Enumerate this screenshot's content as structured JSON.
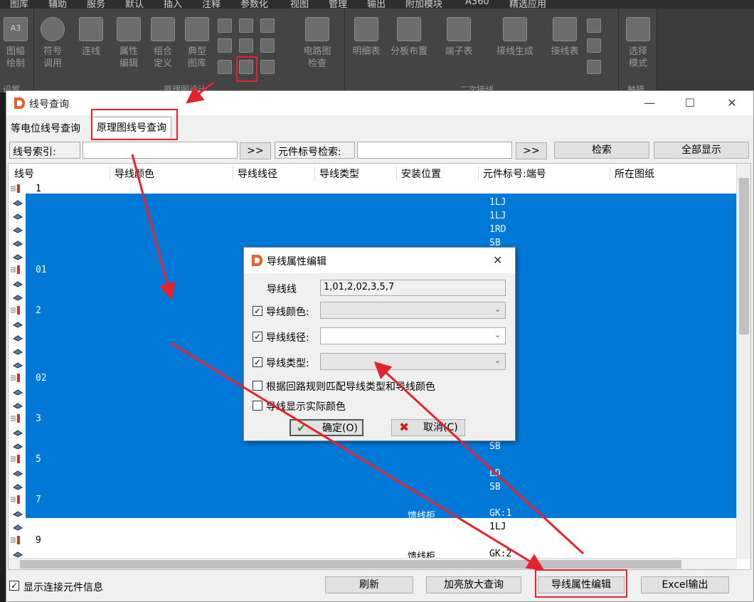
{
  "ribbon": {
    "menu": [
      "图库",
      "辅助",
      "服务",
      "默认",
      "插入",
      "注释",
      "参数化",
      "视图",
      "管理",
      "输出",
      "附加模块",
      "A360",
      "精选应用"
    ],
    "buttons": [
      {
        "line1": "图幅",
        "line2": "绘制"
      },
      {
        "line1": "符号",
        "line2": "调用"
      },
      {
        "line1": "连线",
        "line2": ""
      },
      {
        "line1": "属性",
        "line2": "编辑"
      },
      {
        "line1": "组合",
        "line2": "定义"
      },
      {
        "line1": "典型",
        "line2": "图库"
      },
      {
        "line1": "电路图",
        "line2": "检查"
      },
      {
        "line1": "明细表",
        "line2": ""
      },
      {
        "line1": "分板布置",
        "line2": ""
      },
      {
        "line1": "端子表",
        "line2": ""
      },
      {
        "line1": "接线生成",
        "line2": ""
      },
      {
        "line1": "接线表",
        "line2": ""
      },
      {
        "line1": "选择",
        "line2": "模式"
      }
    ],
    "groups": [
      "设置",
      "原理图设计",
      "二次接线",
      "触摸"
    ],
    "a3_label": "A3"
  },
  "window": {
    "title": "线号查询",
    "tabs": [
      "等电位线号查询",
      "原理图线号查询"
    ],
    "wire_index_label": "线号索引:",
    "wire_index_value": "",
    "elem_search_label": "元件标号检索:",
    "elem_search_value": "",
    "go_label": ">>",
    "search_button": "检索",
    "show_all_button": "全部显示",
    "columns": [
      "线号",
      "导线颜色",
      "导线线径",
      "导线类型",
      "安装位置",
      "元件标号:端号",
      "所在图纸"
    ],
    "rows": [
      {
        "wire": "1",
        "elems": [
          "1LJ",
          "1LJ",
          "1RD",
          "SB"
        ]
      },
      {
        "wire": "01"
      },
      {
        "wire": "2"
      },
      {
        "wire": "02"
      },
      {
        "wire": "3"
      },
      {
        "wire": "5",
        "elems": [
          "SB",
          "LD",
          "SB"
        ]
      },
      {
        "wire": "7",
        "location": "馈线柜",
        "elem": "GK:1"
      },
      {
        "wire": "",
        "elem": "1LJ"
      },
      {
        "wire": "9",
        "location": "馈线柜",
        "elem": "GK:2"
      }
    ],
    "show_conn_label": "显示连接元件信息",
    "show_conn_checked": true,
    "refresh_button": "刷新",
    "zoom_button": "加亮放大查询",
    "edit_button": "导线属性编辑",
    "excel_button": "Excel输出"
  },
  "dialog": {
    "title": "导线属性编辑",
    "wire_label": "导线线",
    "wire_value": "1,01,2,02,3,5,7",
    "color_label": "导线颜色:",
    "color_checked": true,
    "color_value": "",
    "gauge_label": "导线线径:",
    "gauge_checked": true,
    "gauge_value": "",
    "type_label": "导线类型:",
    "type_checked": true,
    "type_value": "",
    "rule_label": "根据回路规则匹配导线类型和导线颜色",
    "rule_checked": false,
    "actual_color_label": "导线显示实际颜色",
    "actual_color_checked": false,
    "ok_button": "确定(O)",
    "cancel_button": "取消(C)"
  },
  "colors": {
    "selection": "#0078d7",
    "annotation": "#e8222c",
    "logo": "#e8622c"
  }
}
